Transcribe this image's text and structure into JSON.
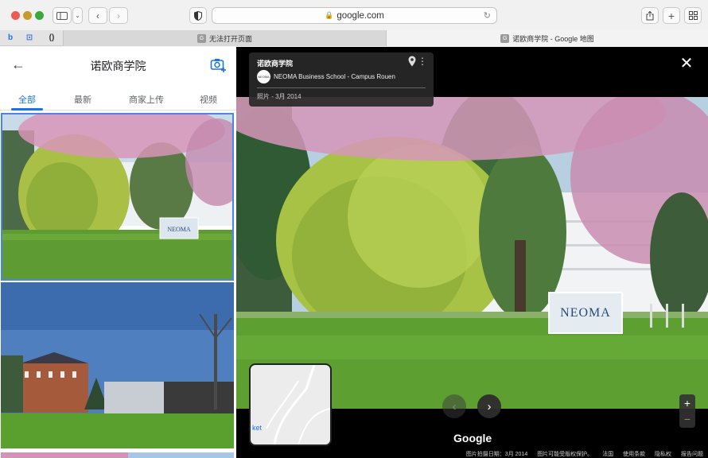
{
  "browser": {
    "url": "google.com",
    "tabs": [
      {
        "label": "无法打开页面",
        "icon": "G"
      },
      {
        "label": "诺欧商学院 - Google 地图",
        "icon": "G"
      }
    ],
    "favorites": [
      "b",
      "⊡",
      "()"
    ]
  },
  "panel": {
    "title": "诺欧商学院",
    "filter_tabs": [
      "全部",
      "最新",
      "商家上传",
      "视频"
    ],
    "active_tab": 0
  },
  "viewer": {
    "place_name": "诺欧商学院",
    "contributor": "NEOMA Business School - Campus Rouen",
    "logo_text": "NEOMA",
    "photo_date": "照片 - 3月 2014",
    "sign_text": "NEOMA",
    "map_label": "ket",
    "google_logo": "Google",
    "footer": [
      "图片拍摄日期：3月 2014",
      "图片可能受版权保护。",
      "法国",
      "使用条款",
      "隐私权",
      "报告问题"
    ]
  },
  "colors": {
    "accent": "#1a73e8",
    "viewer_bg": "#000000",
    "grass": "#5fa23a",
    "blossom": "#d98ab2"
  }
}
